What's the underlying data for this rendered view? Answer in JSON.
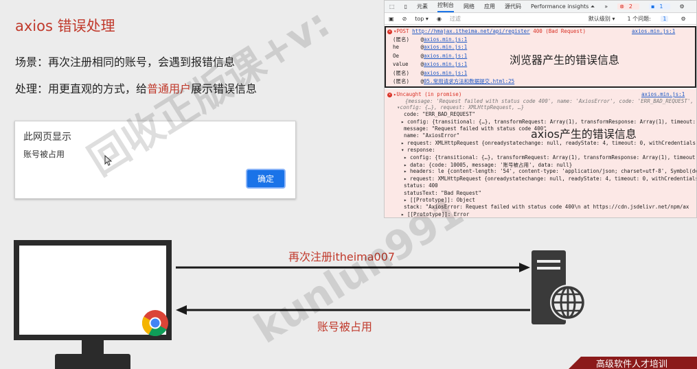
{
  "slide": {
    "title": "axios 错误处理",
    "scene_prefix": "场景：再次注册相同的账号，会遇到报错信息",
    "handle_prefix": "处理：用更直观的方式，给",
    "handle_highlight": "普通用户",
    "handle_suffix": "展示错误信息"
  },
  "dialog": {
    "title": "此网页显示",
    "message": "账号被占用",
    "ok_label": "确定"
  },
  "devtools": {
    "tabs": [
      "元素",
      "控制台",
      "网络",
      "应用",
      "源代码",
      "Performance insights ⏶",
      "»"
    ],
    "active_tab": "控制台",
    "errors_count": "2",
    "info_count": "1",
    "context": "top ▾",
    "filter_placeholder": "过滤",
    "levels": "默认级别 ▾",
    "issues": "1 个问题:",
    "issues_count": "1",
    "err1": {
      "method": "▾POST",
      "url": "http://hmajax.itheima.net/api/register",
      "status": "400 (Bad Request)",
      "source": "axios.min.js:1",
      "stack": [
        {
          "fn": "(匿名)",
          "src": "axios.min.js:1"
        },
        {
          "fn": "he",
          "src": "axios.min.js:1"
        },
        {
          "fn": "Oe",
          "src": "axios.min.js:1"
        },
        {
          "fn": "value",
          "src": "axios.min.js:1"
        },
        {
          "fn": "(匿名)",
          "src": "axios.min.js:1"
        },
        {
          "fn": "(匿名)",
          "src": "05.常用请求方法和数据提交.html:25"
        }
      ]
    },
    "err2": {
      "header": "▸Uncaught (in promise)",
      "source": "axios.min.js:1",
      "summary": "{message: 'Request failed with status code 400', name: 'AxiosError', code: 'ERR_BAD_REQUEST', c",
      "summary2": "▾config: {…}, request: XMLHttpRequest, …}",
      "lines": [
        "code: \"ERR_BAD_REQUEST\"",
        "▸ config: {transitional: {…}, transformRequest: Array(1), transformResponse: Array(1), timeout: 0",
        "message: \"Request failed with status code 400\"",
        "name: \"AxiosError\"",
        "▸ request: XMLHttpRequest {onreadystatechange: null, readyState: 4, timeout: 0, withCredentials: ",
        "▾ response:",
        "  ▸ config: {transitional: {…}, transformRequest: Array(1), transformResponse: Array(1), timeout: ",
        "  ▸ data: {code: 10005, message: '账号被占用', data: null}",
        "  ▸ headers: le {content-length: '54', content-type: 'application/json; charset=utf-8', Symbol(de",
        "  ▸ request: XMLHttpRequest {onreadystatechange: null, readyState: 4, timeout: 0, withCredentials",
        "    status: 400",
        "    statusText: \"Bad Request\"",
        "  ▸ [[Prototype]]: Object",
        "stack: \"AxiosError: Request failed with status code 400\\n    at https://cdn.jsdelivr.net/npm/ax",
        "▸ [[Prototype]]: Error"
      ]
    },
    "note_browser": "浏览器产生的错误信息",
    "note_axios": "axios产生的错误信息"
  },
  "diagram": {
    "request_label": "再次注册itheima007",
    "response_label": "账号被占用"
  },
  "watermark": "回收正版课+v:",
  "watermark2": "kunlun991",
  "banner": "高级软件人才培训"
}
